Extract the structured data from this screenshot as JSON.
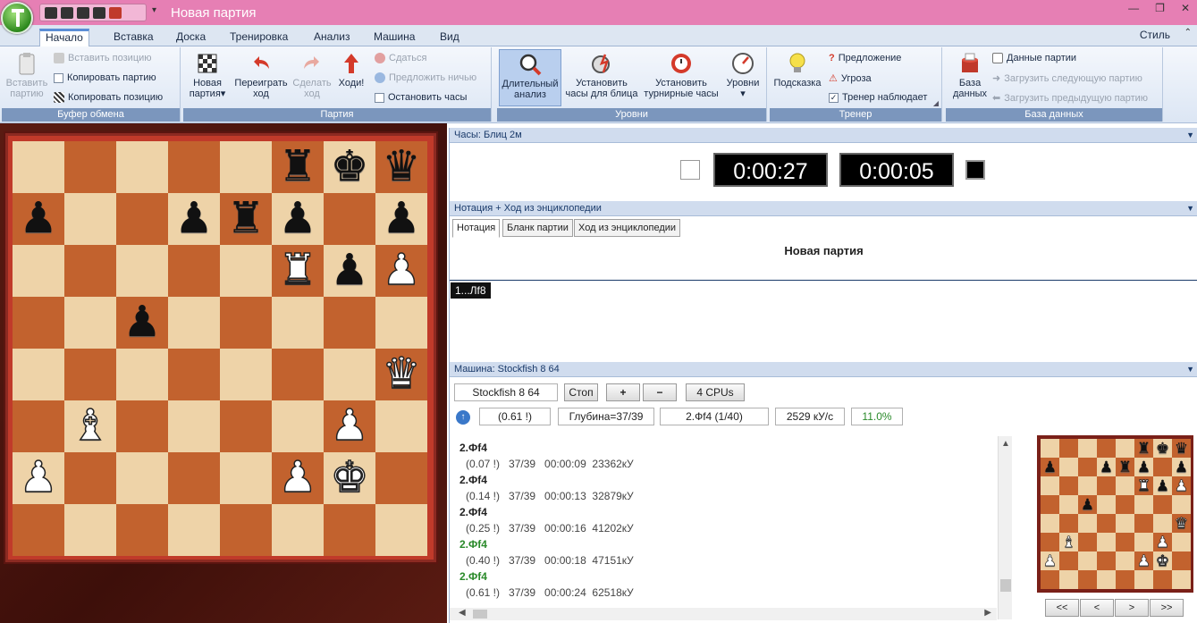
{
  "window": {
    "title": "Новая партия"
  },
  "ribbon_tabs": [
    "Начало",
    "Вставка",
    "Доска",
    "Тренировка",
    "Анализ",
    "Машина",
    "Вид"
  ],
  "style_label": "Стиль",
  "groups": {
    "clipboard": {
      "label": "Буфер обмена",
      "paste_btn": [
        "Вставить",
        "партию"
      ],
      "paste_position": "Вставить позицию",
      "copy_game": "Копировать партию",
      "copy_position": "Копировать позицию"
    },
    "game": {
      "label": "Партия",
      "new_game": [
        "Новая",
        "партия"
      ],
      "replay": [
        "Переиграть",
        "ход"
      ],
      "make_move": [
        "Сделать",
        "ход"
      ],
      "go": "Ходи!",
      "resign": "Сдаться",
      "offer_draw": "Предложить ничью",
      "stop_clocks": "Остановить часы"
    },
    "levels": {
      "label": "Уровни",
      "infinite": [
        "Длительный",
        "анализ"
      ],
      "blitz_clock": [
        "Установить",
        "часы для блица"
      ],
      "tourn_clock": [
        "Установить",
        "турнирные часы"
      ],
      "levels_btn": "Уровни"
    },
    "trainer": {
      "label": "Тренер",
      "hint": "Подсказка",
      "suggestion": "Предложение",
      "threat": "Угроза",
      "trainer_watches": "Тренер наблюдает"
    },
    "database": {
      "label": "База данных",
      "db_btn": [
        "База",
        "данных"
      ],
      "game_data": "Данные партии",
      "load_next": "Загрузить следующую партию",
      "load_prev": "Загрузить предыдущую партию"
    }
  },
  "board": {
    "rows": [
      [
        "",
        "",
        "",
        "",
        "",
        "r",
        "k",
        "q"
      ],
      [
        "p",
        "",
        "",
        "p",
        "r",
        "p",
        "",
        "p"
      ],
      [
        "",
        "",
        "",
        "",
        "",
        "R",
        "p",
        "P"
      ],
      [
        "",
        "",
        "p",
        "",
        "",
        "",
        "",
        ""
      ],
      [
        "",
        "",
        "",
        "",
        "",
        "",
        "",
        "Q"
      ],
      [
        "",
        "B",
        "",
        "",
        "",
        "",
        "P",
        ""
      ],
      [
        "P",
        "",
        "",
        "",
        "",
        "P",
        "K",
        ""
      ],
      [
        "",
        "",
        "",
        "",
        "",
        "",
        "",
        ""
      ]
    ]
  },
  "clock_panel": {
    "header": "Часы: Блиц 2м",
    "white_time": "0:00:27",
    "black_time": "0:00:05"
  },
  "notation_panel": {
    "header": "Нотация + Ход из энциклопедии",
    "tabs": [
      "Нотация",
      "Бланк партии",
      "Ход из энциклопедии"
    ],
    "title": "Новая партия",
    "first_move": "1...Лf8"
  },
  "engine_panel": {
    "header": "Машина: Stockfish 8 64",
    "engine_name": "Stockfish 8 64",
    "stop": "Стоп",
    "plus": "+",
    "minus": "−",
    "cpus": "4 CPUs",
    "eval": "(0.61 !)",
    "depth": "Глубина=37/39",
    "current_move": "2.Фf4 (1/40)",
    "speed": "2529 кУ/с",
    "percent": "11.0%",
    "lines": [
      {
        "move": "2.Фf4",
        "stats": "(0.07 !)   37/39   00:00:09  23362кУ",
        "green": false
      },
      {
        "move": "2.Фf4",
        "stats": "(0.14 !)   37/39   00:00:13  32879кУ",
        "green": false
      },
      {
        "move": "2.Фf4",
        "stats": "(0.25 !)   37/39   00:00:16  41202кУ",
        "green": false
      },
      {
        "move": "2.Фf4",
        "stats": "(0.40 !)   37/39   00:00:18  47151кУ",
        "green": true
      },
      {
        "move": "2.Фf4",
        "stats": "(0.61 !)   37/39   00:00:24  62518кУ",
        "green": true
      }
    ]
  },
  "nav_buttons": [
    "<<",
    "<",
    ">",
    ">>"
  ],
  "icons": [
    "app-orb-icon",
    "save-icon",
    "magnifier-icon",
    "lightbulb-icon",
    "database-icon"
  ]
}
